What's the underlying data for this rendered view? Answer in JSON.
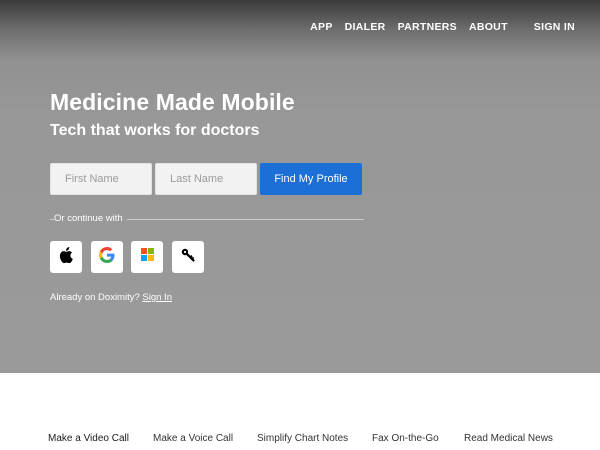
{
  "nav": {
    "items": [
      {
        "label": "APP"
      },
      {
        "label": "DIALER"
      },
      {
        "label": "PARTNERS"
      },
      {
        "label": "ABOUT"
      }
    ],
    "sign_in": "SIGN IN"
  },
  "hero": {
    "headline": "Medicine Made Mobile",
    "subhead": "Tech that works for doctors",
    "first_name_placeholder": "First Name",
    "last_name_placeholder": "Last Name",
    "submit_label": "Find My Profile",
    "continue_label": "Or continue with",
    "providers": [
      {
        "icon": "apple-icon"
      },
      {
        "icon": "google-icon"
      },
      {
        "icon": "microsoft-icon"
      },
      {
        "icon": "key-icon"
      }
    ],
    "already_text": "Already on Doximity?",
    "already_link": "Sign In"
  },
  "features": {
    "items": [
      {
        "label": "Make a Video Call",
        "active": true
      },
      {
        "label": "Make a Voice Call",
        "active": false
      },
      {
        "label": "Simplify Chart Notes",
        "active": false
      },
      {
        "label": "Fax On-the-Go",
        "active": false
      },
      {
        "label": "Read Medical News",
        "active": false
      }
    ]
  },
  "colors": {
    "accent": "#1b6fd6",
    "hero_bg": "#9a9a9a",
    "white": "#ffffff"
  }
}
